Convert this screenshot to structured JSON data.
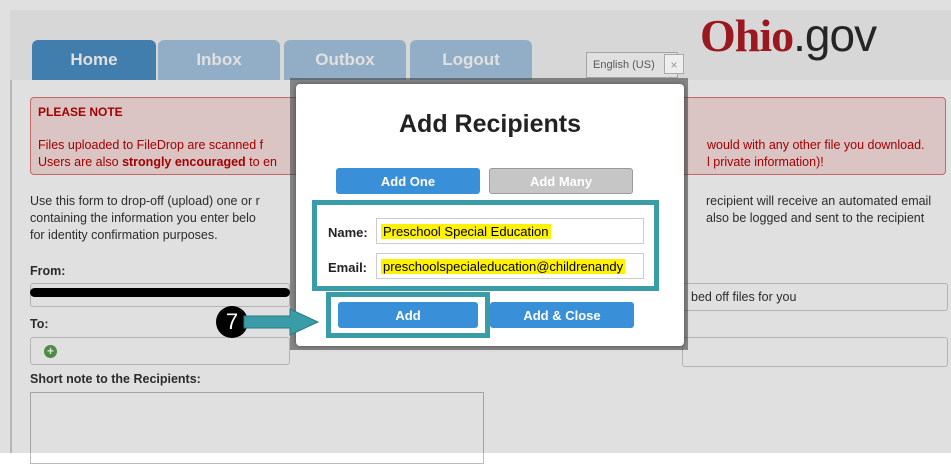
{
  "tabs": {
    "home": "Home",
    "inbox": "Inbox",
    "outbox": "Outbox",
    "logout": "Logout"
  },
  "language": "English (US)",
  "logo": {
    "o": "O",
    "hio": "hio",
    "dot_gov": ".gov"
  },
  "notice": {
    "title": "PLEASE NOTE",
    "line1": "Files uploaded to FileDrop are scanned f",
    "line2_pre": "Users are also ",
    "line2_bold": "strongly encouraged",
    "line2_post": " to en",
    "line1_right": "would with any other file you download.",
    "line2_right": "l private information)!"
  },
  "intro": {
    "left1": "Use this form to drop-off (upload) one or r",
    "left2": "containing the information you enter belo",
    "left3": "for identity confirmation purposes.",
    "right1": "recipient will receive an automated email",
    "right2": "also be logged and sent to the recipient"
  },
  "form": {
    "from_label": "From:",
    "to_label": "To:",
    "from_right": "bed off files for you",
    "note_label": "Short note to the Recipients:"
  },
  "modal": {
    "title": "Add Recipients",
    "add_one": "Add One",
    "add_many": "Add Many",
    "name_label": "Name:",
    "name_value": "Preschool Special Education",
    "email_label": "Email:",
    "email_value": "preschoolspecialeducation@childrenandy",
    "add": "Add",
    "add_close": "Add & Close",
    "close": "×"
  },
  "step": "7",
  "colors": {
    "accent": "#3a8fd9",
    "highlight": "#3a9ca6",
    "logo_red": "#b01c24"
  }
}
